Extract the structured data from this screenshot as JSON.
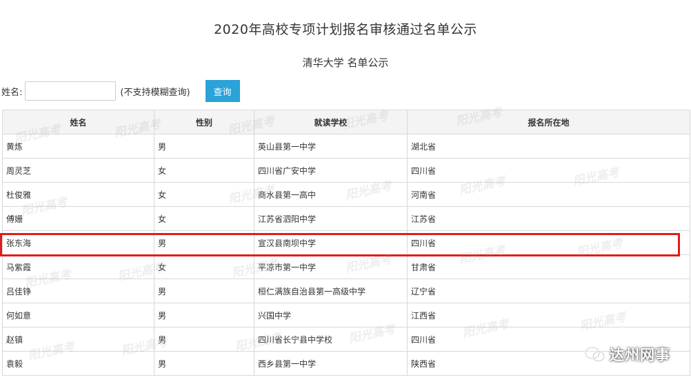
{
  "page": {
    "title": "2020年高校专项计划报名审核通过名单公示",
    "subtitle": "清华大学 名单公示"
  },
  "search": {
    "label": "姓名:",
    "value": "",
    "placeholder": "",
    "hint": "(不支持模糊查询)",
    "button_label": "查询"
  },
  "table": {
    "headers": [
      "姓名",
      "性别",
      "就读学校",
      "报名所在地"
    ],
    "rows": [
      [
        "黄炼",
        "男",
        "英山县第一中学",
        "湖北省"
      ],
      [
        "周灵芝",
        "女",
        "四川省广安中学",
        "四川省"
      ],
      [
        "杜俊雅",
        "女",
        "商水县第一高中",
        "河南省"
      ],
      [
        "傅姗",
        "女",
        "江苏省泗阳中学",
        "江苏省"
      ],
      [
        "张东海",
        "男",
        "宣汉县南坝中学",
        "四川省"
      ],
      [
        "马紫霞",
        "女",
        "平凉市第一中学",
        "甘肃省"
      ],
      [
        "吕佳铮",
        "男",
        "桓仁满族自治县第一高级中学",
        "辽宁省"
      ],
      [
        "何如意",
        "男",
        "兴国中学",
        "江西省"
      ],
      [
        "赵镇",
        "男",
        "四川省长宁县中学校",
        "四川省"
      ],
      [
        "袁毅",
        "男",
        "西乡县第一中学",
        "陕西省"
      ]
    ],
    "highlighted_row": 5
  },
  "watermark": {
    "text": "阳光高考"
  },
  "brand": {
    "text": "达州网事",
    "icon": "wechat-icon"
  },
  "colors": {
    "button": "#2ba2d8",
    "highlight": "#e31b1b",
    "header_bg": "#f4f4f4",
    "border": "#d8d8d8"
  }
}
